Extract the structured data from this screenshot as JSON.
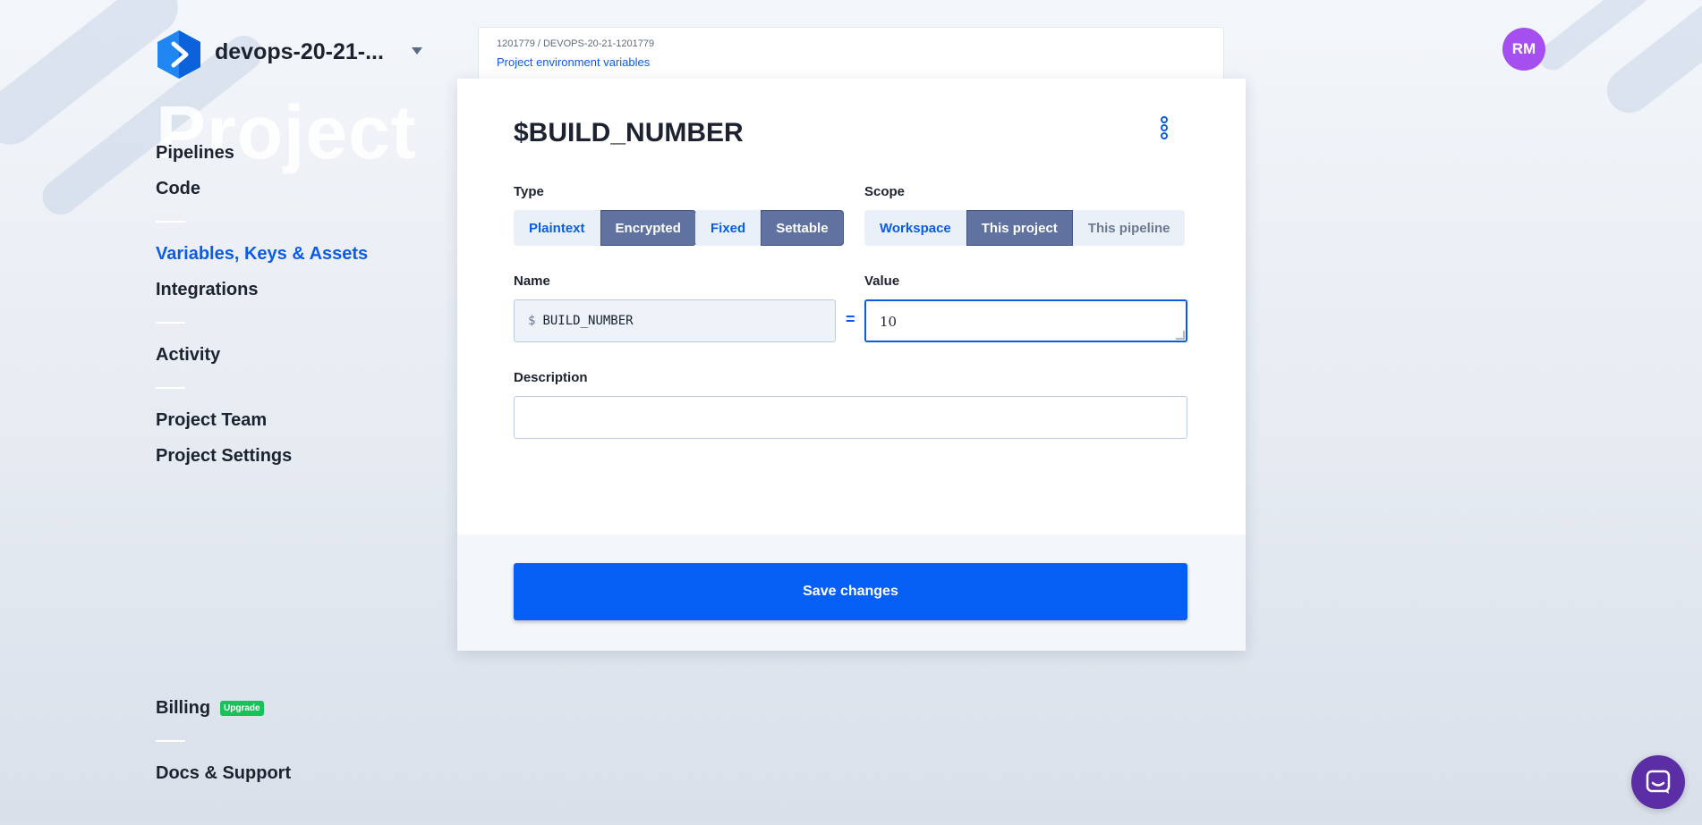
{
  "sidebar": {
    "project_name": "devops-20-21-...",
    "ghost_heading": "Project",
    "nav": {
      "pipelines": "Pipelines",
      "code": "Code",
      "variables": "Variables, Keys & Assets",
      "integrations": "Integrations",
      "activity": "Activity",
      "project_team": "Project Team",
      "project_settings": "Project Settings",
      "billing": "Billing",
      "upgrade": "Upgrade",
      "docs": "Docs & Support"
    }
  },
  "breadcrumb": {
    "path": "1201779 / DEVOPS-20-21-1201779",
    "title": "Project environment variables"
  },
  "modal": {
    "title": "$BUILD_NUMBER",
    "type_label": "Type",
    "type_options": {
      "plaintext": "Plaintext",
      "encrypted": "Encrypted"
    },
    "mode_options": {
      "fixed": "Fixed",
      "settable": "Settable"
    },
    "scope_label": "Scope",
    "scope_options": {
      "workspace": "Workspace",
      "this_project": "This project",
      "this_pipeline": "This pipeline"
    },
    "name_label": "Name",
    "name_prefix": "$",
    "name_value": "BUILD_NUMBER",
    "equals": "=",
    "value_label": "Value",
    "value_value": "10",
    "description_label": "Description",
    "description_value": "",
    "save_label": "Save changes"
  },
  "user": {
    "initials": "RM"
  },
  "colors": {
    "accent": "#0a5ce6",
    "selected": "#5f72a0",
    "avatar": "#a64ff0",
    "chat": "#5b2ea6",
    "badge": "#19c15b"
  }
}
